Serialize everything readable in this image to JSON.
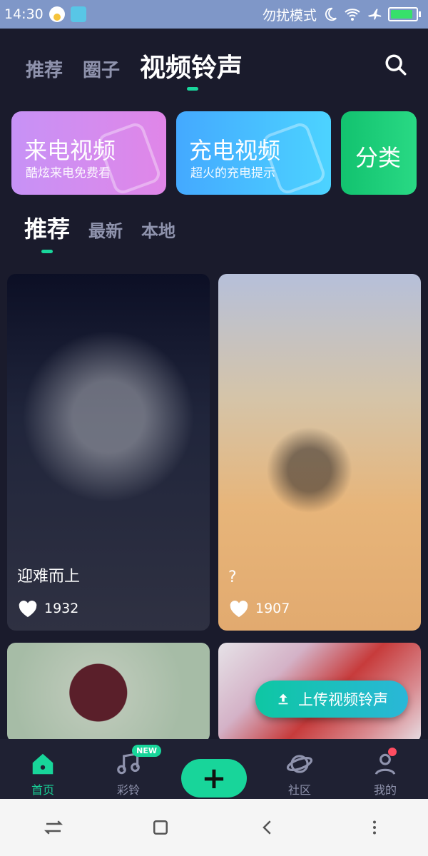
{
  "status_bar": {
    "time": "14:30",
    "dnd_text": "勿扰模式",
    "icons": [
      "qq-icon",
      "usb-icon",
      "moon-icon",
      "wifi-icon",
      "airplane-icon",
      "battery-icon"
    ]
  },
  "header": {
    "tabs": [
      {
        "label": "推荐",
        "active": false
      },
      {
        "label": "圈子",
        "active": false
      },
      {
        "label": "视频铃声",
        "active": true
      }
    ],
    "search_icon": "search-icon"
  },
  "banners": [
    {
      "title": "来电视频",
      "subtitle": "酷炫来电免费看",
      "color": "#d28cf2"
    },
    {
      "title": "充电视频",
      "subtitle": "超火的充电提示",
      "color": "#45bfff"
    },
    {
      "title": "分类",
      "subtitle": "",
      "color": "#18cc77"
    }
  ],
  "subtabs": [
    {
      "label": "推荐",
      "active": true
    },
    {
      "label": "最新",
      "active": false
    },
    {
      "label": "本地",
      "active": false
    }
  ],
  "cards": [
    {
      "title": "迎难而上",
      "likes": "1932"
    },
    {
      "title": "?",
      "likes": "1907"
    },
    {
      "title": "",
      "likes": ""
    },
    {
      "title": "",
      "likes": ""
    }
  ],
  "upload_button": {
    "label": "上传视频铃声"
  },
  "bottom_nav": {
    "items": [
      {
        "label": "首页",
        "icon": "home-icon",
        "active": true
      },
      {
        "label": "彩铃",
        "icon": "music-note-icon",
        "badge": "NEW"
      },
      {
        "label": "",
        "icon": "plus-icon"
      },
      {
        "label": "社区",
        "icon": "planet-icon"
      },
      {
        "label": "我的",
        "icon": "profile-icon",
        "dot": true
      }
    ]
  },
  "accent_color": "#18d59a"
}
